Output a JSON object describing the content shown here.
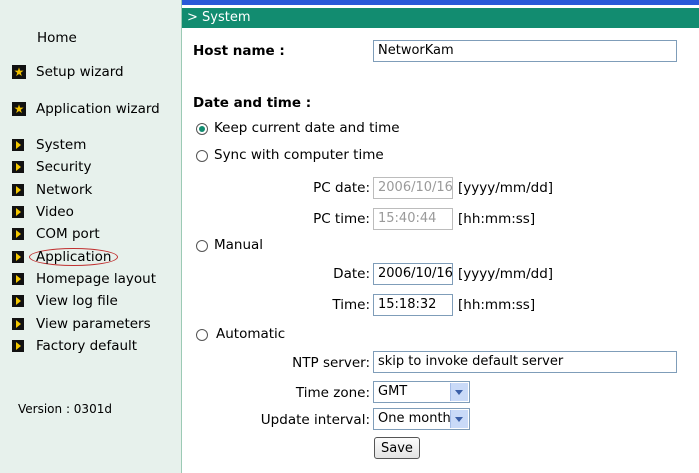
{
  "sidebar": {
    "home": "Home",
    "setup_wizard": "Setup wizard",
    "application_wizard": "Application wizard",
    "items": [
      {
        "label": "System"
      },
      {
        "label": "Security"
      },
      {
        "label": "Network"
      },
      {
        "label": "Video"
      },
      {
        "label": "COM port"
      },
      {
        "label": "Application"
      },
      {
        "label": "Homepage layout"
      },
      {
        "label": "View log file"
      },
      {
        "label": "View parameters"
      },
      {
        "label": "Factory default"
      }
    ],
    "version": "Version : 0301d"
  },
  "header": {
    "title": "> System"
  },
  "host": {
    "label": "Host name :",
    "value": "NetworKam"
  },
  "datetime": {
    "heading": "Date and time :",
    "keep_label": "Keep current date and time",
    "sync_label": "Sync with computer time",
    "pc_date_label": "PC date:",
    "pc_date_value": "2006/10/16",
    "pc_date_format": "[yyyy/mm/dd]",
    "pc_time_label": "PC time:",
    "pc_time_value": "15:40:44",
    "pc_time_format": "[hh:mm:ss]",
    "manual_label": "Manual",
    "date_label": "Date:",
    "date_value": "2006/10/16",
    "date_format": "[yyyy/mm/dd]",
    "time_label": "Time:",
    "time_value": "15:18:32",
    "time_format": "[hh:mm:ss]",
    "automatic_label": "Automatic",
    "ntp_label": "NTP server:",
    "ntp_value": "skip to invoke default server",
    "timezone_label": "Time zone:",
    "timezone_value": "GMT",
    "interval_label": "Update interval:",
    "interval_value": "One month",
    "selected_mode": "keep"
  },
  "actions": {
    "save": "Save"
  },
  "colors": {
    "header_bg": "#128c70",
    "sidebar_bg": "#e7f1ec",
    "topbar": "#2a59d8"
  }
}
